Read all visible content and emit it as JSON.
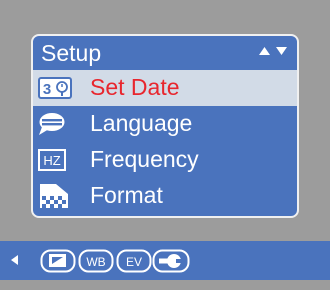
{
  "menu": {
    "title": "Setup",
    "items": [
      {
        "label": "Set Date",
        "icon": "calendar-clock-icon",
        "badge": "3",
        "selected": true
      },
      {
        "label": "Language",
        "icon": "speech-bubble-icon",
        "selected": false
      },
      {
        "label": "Frequency",
        "icon": "hz-icon",
        "badge": "HZ",
        "selected": false
      },
      {
        "label": "Format",
        "icon": "memory-card-format-icon",
        "selected": false
      }
    ]
  },
  "mode_bar": {
    "icons": [
      {
        "name": "image-size-icon"
      },
      {
        "name": "white-balance-icon",
        "text": "WB"
      },
      {
        "name": "exposure-value-icon",
        "text": "EV"
      },
      {
        "name": "setup-wrench-icon",
        "active": true
      }
    ]
  },
  "colors": {
    "background": "#9c9c9c",
    "panel": "#4a73bd",
    "selected_row": "#d2dbe7",
    "selected_text": "#e8262e",
    "text": "#ffffff"
  }
}
